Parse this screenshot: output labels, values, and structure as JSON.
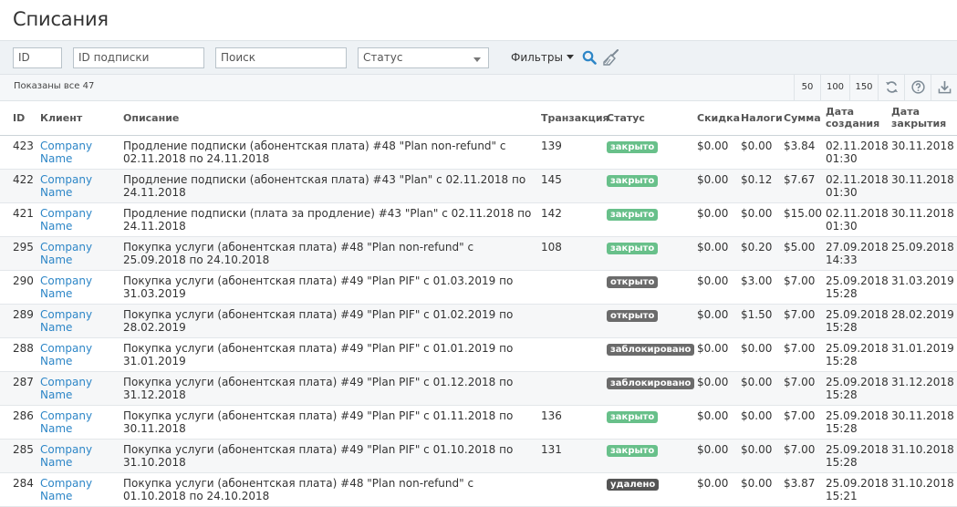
{
  "title": "Списания",
  "filters": {
    "id_placeholder": "ID",
    "subscription_placeholder": "ID подписки",
    "search_placeholder": "Поиск",
    "status_placeholder": "Статус",
    "filters_label": "Фильтры"
  },
  "toolbar": {
    "count_text": "Показаны все 47",
    "page_sizes": [
      "50",
      "100",
      "150"
    ]
  },
  "columns": {
    "id": "ID",
    "client": "Клиент",
    "description": "Описание",
    "transaction": "Транзакция",
    "status": "Статус",
    "discount": "Скидка",
    "taxes": "Налоги",
    "amount": "Сумма",
    "created": "Дата создания",
    "closed": "Дата закрытия"
  },
  "status_colors": {
    "закрыто": "#68c08a",
    "открыто": "#6b6b6b",
    "заблокировано": "#6b6b6b",
    "удалено": "#555555"
  },
  "rows": [
    {
      "id": "423",
      "client": "Company Name",
      "description": "Продление подписки (абонентская плата) #48 \"Plan non-refund\" с 02.11.2018 по 24.11.2018",
      "transaction": "139",
      "status": "закрыто",
      "discount": "$0.00",
      "taxes": "$0.00",
      "amount": "$3.84",
      "created": "02.11.2018 01:30",
      "closed": "30.11.2018"
    },
    {
      "id": "422",
      "client": "Company Name",
      "description": "Продление подписки (абонентская плата) #43 \"Plan\" с 02.11.2018 по 24.11.2018",
      "transaction": "145",
      "status": "закрыто",
      "discount": "$0.00",
      "taxes": "$0.12",
      "amount": "$7.67",
      "created": "02.11.2018 01:30",
      "closed": "30.11.2018"
    },
    {
      "id": "421",
      "client": "Company Name",
      "description": "Продление подписки (плата за продление) #43 \"Plan\" с 02.11.2018 по 24.11.2018",
      "transaction": "142",
      "status": "закрыто",
      "discount": "$0.00",
      "taxes": "$0.00",
      "amount": "$15.00",
      "created": "02.11.2018 01:30",
      "closed": "30.11.2018"
    },
    {
      "id": "295",
      "client": "Company Name",
      "description": "Покупка услуги (абонентская плата) #48 \"Plan non-refund\" с 25.09.2018 по 24.10.2018",
      "transaction": "108",
      "status": "закрыто",
      "discount": "$0.00",
      "taxes": "$0.20",
      "amount": "$5.00",
      "created": "27.09.2018 14:33",
      "closed": "25.09.2018"
    },
    {
      "id": "290",
      "client": "Company Name",
      "description": "Покупка услуги (абонентская плата) #49 \"Plan PIF\" с 01.03.2019 по 31.03.2019",
      "transaction": "",
      "status": "открыто",
      "discount": "$0.00",
      "taxes": "$3.00",
      "amount": "$7.00",
      "created": "25.09.2018 15:28",
      "closed": "31.03.2019"
    },
    {
      "id": "289",
      "client": "Company Name",
      "description": "Покупка услуги (абонентская плата) #49 \"Plan PIF\" с 01.02.2019 по 28.02.2019",
      "transaction": "",
      "status": "открыто",
      "discount": "$0.00",
      "taxes": "$1.50",
      "amount": "$7.00",
      "created": "25.09.2018 15:28",
      "closed": "28.02.2019"
    },
    {
      "id": "288",
      "client": "Company Name",
      "description": "Покупка услуги (абонентская плата) #49 \"Plan PIF\" с 01.01.2019 по 31.01.2019",
      "transaction": "",
      "status": "заблокировано",
      "discount": "$0.00",
      "taxes": "$0.00",
      "amount": "$7.00",
      "created": "25.09.2018 15:28",
      "closed": "31.01.2019"
    },
    {
      "id": "287",
      "client": "Company Name",
      "description": "Покупка услуги (абонентская плата) #49 \"Plan PIF\" с 01.12.2018 по 31.12.2018",
      "transaction": "",
      "status": "заблокировано",
      "discount": "$0.00",
      "taxes": "$0.00",
      "amount": "$7.00",
      "created": "25.09.2018 15:28",
      "closed": "31.12.2018"
    },
    {
      "id": "286",
      "client": "Company Name",
      "description": "Покупка услуги (абонентская плата) #49 \"Plan PIF\" с 01.11.2018 по 30.11.2018",
      "transaction": "136",
      "status": "закрыто",
      "discount": "$0.00",
      "taxes": "$0.00",
      "amount": "$7.00",
      "created": "25.09.2018 15:28",
      "closed": "30.11.2018"
    },
    {
      "id": "285",
      "client": "Company Name",
      "description": "Покупка услуги (абонентская плата) #49 \"Plan PIF\" с 01.10.2018 по 31.10.2018",
      "transaction": "131",
      "status": "закрыто",
      "discount": "$0.00",
      "taxes": "$0.00",
      "amount": "$7.00",
      "created": "25.09.2018 15:28",
      "closed": "31.10.2018"
    },
    {
      "id": "284",
      "client": "Company Name",
      "description": "Покупка услуги (абонентская плата) #48 \"Plan non-refund\" с 01.10.2018 по 24.10.2018",
      "transaction": "",
      "status": "удалено",
      "discount": "$0.00",
      "taxes": "$0.00",
      "amount": "$3.87",
      "created": "25.09.2018 15:21",
      "closed": "31.10.2018"
    }
  ]
}
